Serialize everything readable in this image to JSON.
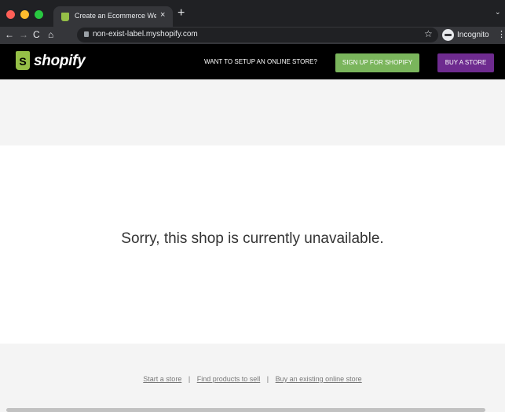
{
  "browser": {
    "tab_title": "Create an Ecommerce Website",
    "tab_close": "×",
    "new_tab": "+",
    "tab_menu": "⌄",
    "url": "non-exist-label.myshopify.com",
    "profile_label": "Incognito",
    "icons": {
      "back": "←",
      "forward": "→",
      "reload": "C",
      "home": "⌂",
      "star": "☆",
      "menu": "⋮"
    }
  },
  "header": {
    "logo_text": "shopify",
    "logo_letter": "S",
    "setup_text": "WANT TO SETUP AN ONLINE STORE?",
    "signup_label": "SIGN UP FOR SHOPIFY",
    "buy_label": "BUY A STORE",
    "colors": {
      "brand_green": "#95bf47",
      "signup_green": "#7ab55c",
      "buy_purple": "#6e2b8f"
    }
  },
  "main": {
    "message": "Sorry, this shop is currently unavailable."
  },
  "footer": {
    "links": [
      "Start a store",
      "Find products to sell",
      "Buy an existing online store"
    ],
    "separator": "|"
  }
}
